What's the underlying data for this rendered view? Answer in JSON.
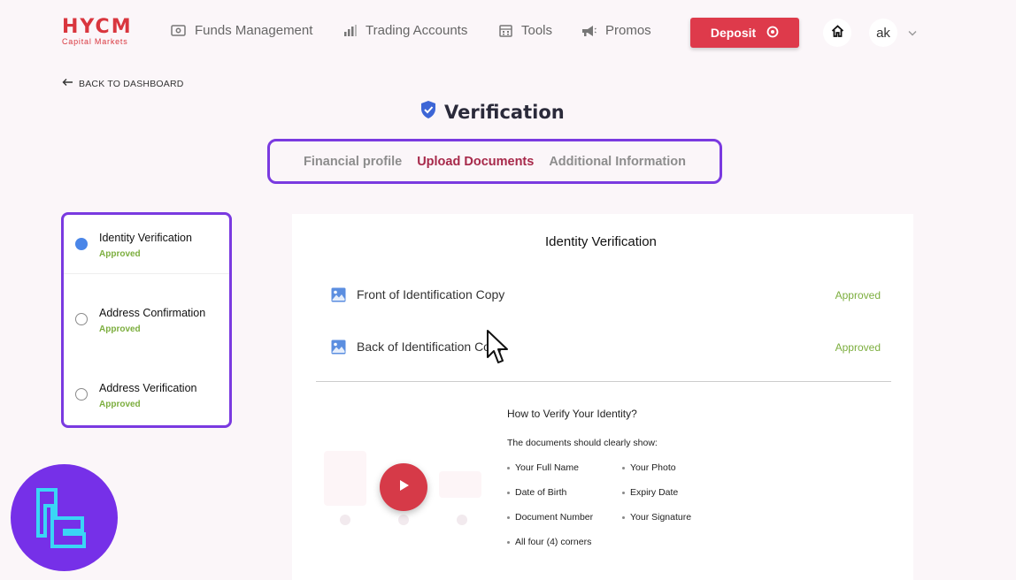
{
  "brand": {
    "name": "HYCM",
    "tagline": "Capital Markets",
    "color": "#d9363e"
  },
  "nav": {
    "items": [
      {
        "label": "Funds Management",
        "icon": "wallet-icon"
      },
      {
        "label": "Trading Accounts",
        "icon": "bar-chart-icon"
      },
      {
        "label": "Tools",
        "icon": "calculator-icon"
      },
      {
        "label": "Promos",
        "icon": "megaphone-icon"
      }
    ],
    "deposit_label": "Deposit",
    "user_initials": "ak"
  },
  "back_link": "BACK TO DASHBOARD",
  "page_title": "Verification",
  "tabs": [
    {
      "label": "Financial profile",
      "active": false
    },
    {
      "label": "Upload Documents",
      "active": true
    },
    {
      "label": "Additional Information",
      "active": false
    }
  ],
  "steps": [
    {
      "label": "Identity Verification",
      "status": "Approved",
      "selected": true
    },
    {
      "label": "Address Confirmation",
      "status": "Approved",
      "selected": false
    },
    {
      "label": "Address Verification",
      "status": "Approved",
      "selected": false
    }
  ],
  "panel": {
    "title": "Identity Verification",
    "documents": [
      {
        "name": "Front of Identification Copy",
        "status": "Approved"
      },
      {
        "name": "Back of Identification Copy",
        "status": "Approved"
      }
    ]
  },
  "howto": {
    "title": "How to Verify Your Identity?",
    "subtitle": "The documents should clearly show:",
    "requirements": [
      "Your Full Name",
      "Your Photo",
      "Date of Birth",
      "Expiry Date",
      "Document Number",
      "Your Signature",
      "All four (4) corners"
    ]
  },
  "colors": {
    "accent_red": "#de3a4b",
    "highlight_purple": "#7a3ae0",
    "approved_green": "#7cae3e",
    "active_tab": "#a7294a"
  }
}
